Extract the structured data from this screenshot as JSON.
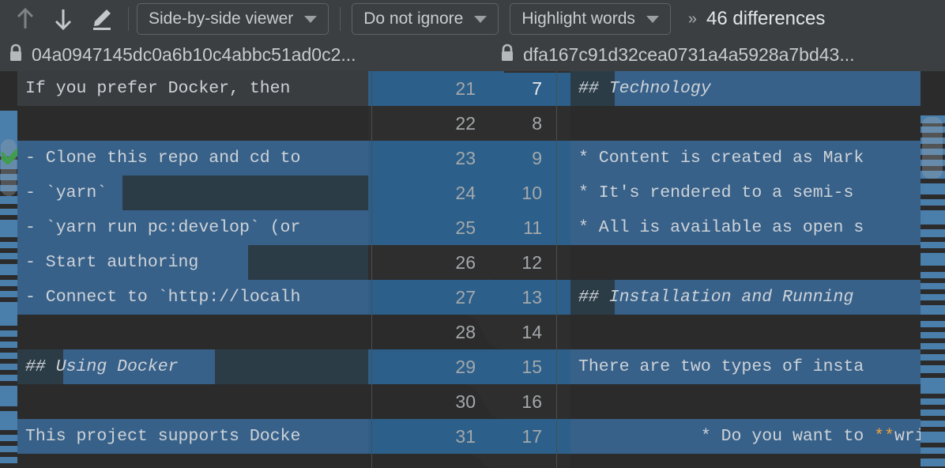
{
  "toolbar": {
    "icons": [
      {
        "name": "previous-difference-icon",
        "glyph": "arrow-up"
      },
      {
        "name": "next-difference-icon",
        "glyph": "arrow-down"
      },
      {
        "name": "edit-icon",
        "glyph": "pencil"
      }
    ],
    "viewer_mode": "Side-by-side viewer",
    "ignore_policy": "Do not ignore",
    "highlight_mode": "Highlight words",
    "overflow_label": "»",
    "difference_count": "46 differences"
  },
  "paths": {
    "left": "04a0947145dc0a6b10c4abbc51ad0c2...",
    "right": "dfa167c91d32cea0731a4a5928a7bd43...",
    "left_icon": "lock-icon",
    "right_icon": "lock-icon"
  },
  "status": {
    "left_accept_icon": "green-check-icon",
    "right_accept_icon": "green-check-icon"
  },
  "colors": {
    "toolbar_bg": "#3c3f41",
    "editor_bg": "#2b2b2b",
    "changed_line_bg": "#2c3c47",
    "word_diff_bg": "#38618a",
    "marker_blue": "#4a7eab",
    "heading_pink": "#cf8fd4",
    "bold_orange": "#e8a33d",
    "text_fg": "#cdd3d8",
    "check_green": "#3f9e4d"
  },
  "gutter": {
    "left_numbers": [
      "21",
      "22",
      "23",
      "24",
      "25",
      "26",
      "27",
      "28",
      "29",
      "30",
      "31"
    ],
    "right_numbers": [
      "7",
      "8",
      "9",
      "10",
      "11",
      "12",
      "13",
      "14",
      "15",
      "16",
      "17"
    ],
    "current_right_number": "7"
  },
  "left_pane": {
    "lines": [
      {
        "num": "21",
        "text": "If you prefer Docker, then",
        "kind": "context"
      },
      {
        "num": "22",
        "text": "",
        "kind": "unchanged"
      },
      {
        "num": "23",
        "text": "- Clone this repo and cd to",
        "kind": "changed"
      },
      {
        "num": "24",
        "text": "- `yarn`",
        "kind": "changed"
      },
      {
        "num": "25",
        "text": "- `yarn run pc:develop` (or",
        "kind": "changed"
      },
      {
        "num": "26",
        "text": "- Start authoring",
        "kind": "changed"
      },
      {
        "num": "27",
        "text": "- Connect to `http://localh",
        "kind": "changed"
      },
      {
        "num": "28",
        "text": "",
        "kind": "unchanged"
      },
      {
        "num": "29",
        "text": "## Using Docker",
        "kind": "changed"
      },
      {
        "num": "30",
        "text": "",
        "kind": "unchanged"
      },
      {
        "num": "31",
        "text": "This project supports Docke",
        "kind": "changed"
      }
    ]
  },
  "right_pane": {
    "lines": [
      {
        "num": "7",
        "text": "## Technology",
        "kind": "changed"
      },
      {
        "num": "8",
        "text": "",
        "kind": "unchanged"
      },
      {
        "num": "9",
        "text": "* Content is created as Mark",
        "kind": "changed"
      },
      {
        "num": "10",
        "text": "* It's rendered to a semi-s",
        "kind": "changed"
      },
      {
        "num": "11",
        "text": "* All is available as open s",
        "kind": "changed"
      },
      {
        "num": "12",
        "text": "",
        "kind": "unchanged"
      },
      {
        "num": "13",
        "text": "## Installation and Running",
        "kind": "changed"
      },
      {
        "num": "14",
        "text": "",
        "kind": "unchanged"
      },
      {
        "num": "15",
        "text": "There are two types of insta",
        "kind": "changed"
      },
      {
        "num": "16",
        "text": "",
        "kind": "unchanged"
      },
      {
        "num": "17",
        "text": "* Do you want to **write co",
        "kind": "changed"
      }
    ]
  }
}
